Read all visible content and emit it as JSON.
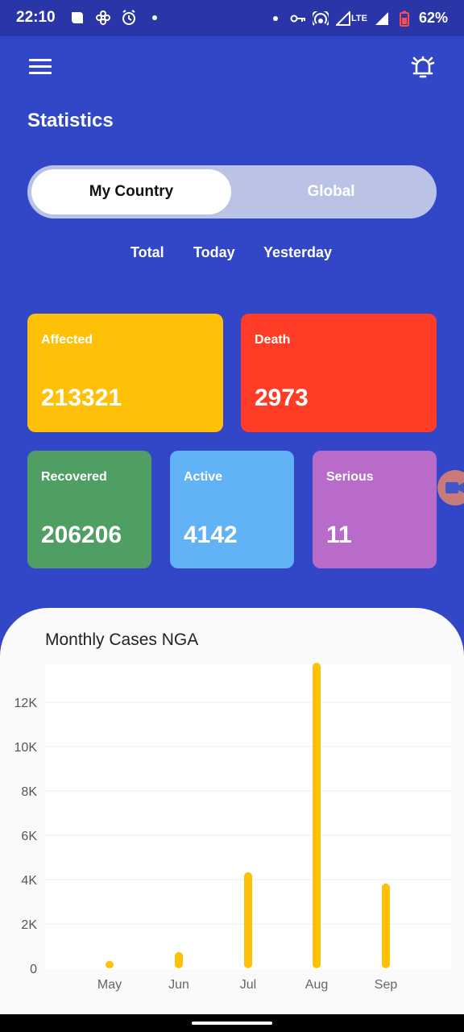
{
  "status_bar": {
    "time": "22:10",
    "battery": "62%",
    "network_label": "LTE",
    "icons": [
      "messaging-icon",
      "pinwheel-icon",
      "alarm-icon",
      "dot-icon",
      "vpn-key-icon",
      "hotspot-icon",
      "signal-icon",
      "signal-icon",
      "battery-icon"
    ]
  },
  "app_bar": {
    "menu_icon": "hamburger-menu-icon",
    "alert_icon": "alarm-bell-icon"
  },
  "page": {
    "title": "Statistics"
  },
  "toggle": {
    "active": "My Country",
    "inactive": "Global"
  },
  "period_tabs": [
    "Total",
    "Today",
    "Yesterday"
  ],
  "cards": {
    "affected": {
      "label": "Affected",
      "value": "213321",
      "color": "#ffc107"
    },
    "death": {
      "label": "Death",
      "value": "2973",
      "color": "#ff3d27"
    },
    "recovered": {
      "label": "Recovered",
      "value": "206206",
      "color": "#4f9e63"
    },
    "active": {
      "label": "Active",
      "value": "4142",
      "color": "#62b3f6"
    },
    "serious": {
      "label": "Serious",
      "value": "11",
      "color": "#b96bc9"
    }
  },
  "chart": {
    "title": "Monthly Cases NGA"
  },
  "chart_data": {
    "type": "bar",
    "title": "Monthly Cases NGA",
    "categories": [
      "May",
      "Jun",
      "Jul",
      "Aug",
      "Sep"
    ],
    "values": [
      150,
      550,
      4150,
      13600,
      3650
    ],
    "ylim": [
      0,
      13600
    ],
    "yticks": [
      0,
      2000,
      4000,
      6000,
      8000,
      10000,
      12000
    ],
    "ytick_labels": [
      "0",
      "2K",
      "4K",
      "6K",
      "8K",
      "10K",
      "12K"
    ],
    "grid": true,
    "bar_color": "#ffc107"
  }
}
